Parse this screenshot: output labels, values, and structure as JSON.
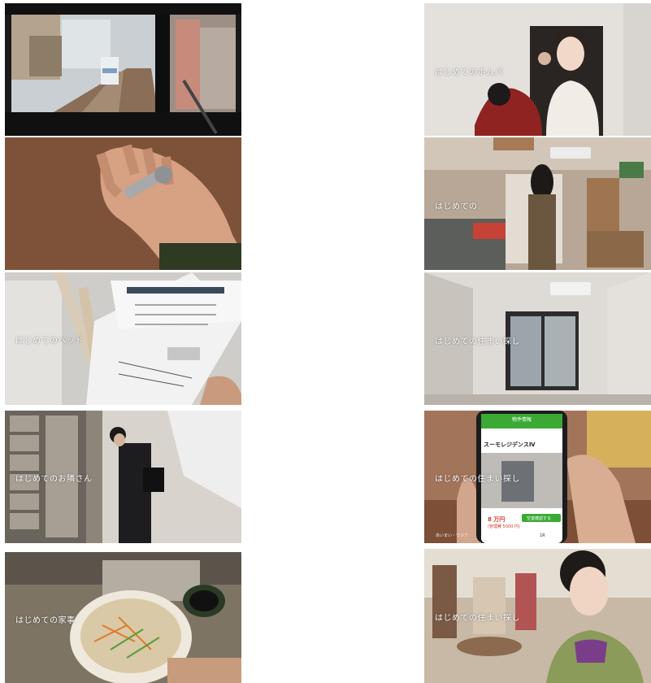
{
  "frames": {
    "left_1": {
      "caption": "",
      "subject": "train-cab-view"
    },
    "left_2": {
      "caption": "",
      "subject": "hand-holding-keys"
    },
    "left_3": {
      "caption": "はじめてのベッド"
    },
    "left_4": {
      "caption": "はじめてのお隣さん"
    },
    "left_5": {
      "caption": "はじめての家事"
    },
    "right_1": {
      "caption": "はじめてのホムパ"
    },
    "right_2": {
      "caption": "はじめての"
    },
    "right_3": {
      "caption": "はじめての住まい探し"
    },
    "right_4": {
      "caption": "はじめての住まい探し",
      "phone": {
        "header": "物件情報",
        "property_name": "スーモレジデンスⅣ",
        "price": "8 万円",
        "price_sub": "(管理費 5000 円)",
        "cta": "空室確認する",
        "floorplan": "1R",
        "small_corner": "あいまい・ワスア"
      }
    },
    "right_5": {
      "caption": "はじめての住まい探し"
    }
  },
  "colors": {
    "background": "#ffffff",
    "caption": "#ffffff",
    "phone_header": "#3aaa35",
    "price": "#d8392b"
  }
}
